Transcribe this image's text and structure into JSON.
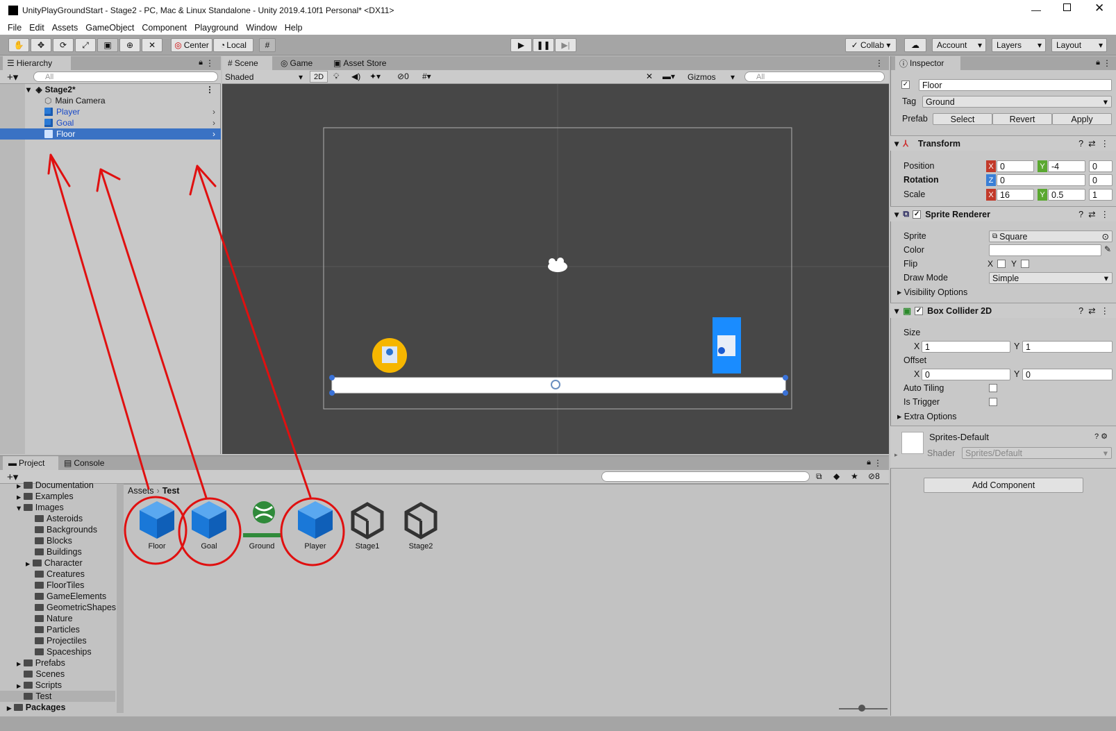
{
  "window": {
    "title": "UnityPlayGroundStart - Stage2 - PC, Mac & Linux Standalone - Unity 2019.4.10f1 Personal* <DX11>"
  },
  "menu": [
    "File",
    "Edit",
    "Assets",
    "GameObject",
    "Component",
    "Playground",
    "Window",
    "Help"
  ],
  "toolbar": {
    "pivot": "Center",
    "space": "Local",
    "collab": "Collab",
    "account": "Account",
    "layers": "Layers",
    "layout": "Layout"
  },
  "hierarchy": {
    "tab": "Hierarchy",
    "search": "All",
    "scene": "Stage2*",
    "items": [
      {
        "label": "Main Camera"
      },
      {
        "label": "Player"
      },
      {
        "label": "Goal"
      },
      {
        "label": "Floor"
      }
    ]
  },
  "scene": {
    "tabs": [
      "Scene",
      "Game",
      "Asset Store"
    ],
    "shading": "Shaded",
    "mode2d": "2D",
    "hidden_count": "0",
    "gizmos": "Gizmos",
    "search": "All"
  },
  "inspector": {
    "tab": "Inspector",
    "object_name": "Floor",
    "tag_label": "Tag",
    "tag": "Ground",
    "prefab_label": "Prefab",
    "prefab_select": "Select",
    "prefab_revert": "Revert",
    "prefab_apply": "Apply",
    "transform": {
      "title": "Transform",
      "position_label": "Position",
      "rotation_label": "Rotation",
      "scale_label": "Scale",
      "pos_x": "0",
      "pos_y": "-4",
      "pos_z": "0",
      "rot_z": "0",
      "rot_end": "0",
      "scale_x": "16",
      "scale_y": "0.5",
      "scale_z": "1"
    },
    "sprite_renderer": {
      "title": "Sprite Renderer",
      "sprite_label": "Sprite",
      "sprite": "Square",
      "color_label": "Color",
      "flip_label": "Flip",
      "draw_mode_label": "Draw Mode",
      "draw_mode": "Simple",
      "visibility": "Visibility Options"
    },
    "box_collider": {
      "title": "Box Collider 2D",
      "size_label": "Size",
      "size_x": "1",
      "size_y": "1",
      "offset_label": "Offset",
      "offset_x": "0",
      "offset_y": "0",
      "auto_tiling": "Auto Tiling",
      "is_trigger": "Is Trigger",
      "extra": "Extra Options"
    },
    "material": {
      "name": "Sprites-Default",
      "shader_label": "Shader",
      "shader": "Sprites/Default"
    },
    "add_component": "Add Component"
  },
  "project": {
    "tabs": [
      "Project",
      "Console"
    ],
    "hidden_count": "8",
    "breadcrumb": {
      "root": "Assets",
      "current": "Test"
    },
    "tree": [
      "Documentation",
      "Examples",
      "Images",
      "Asteroids",
      "Backgrounds",
      "Blocks",
      "Buildings",
      "Character",
      "Creatures",
      "FloorTiles",
      "GameElements",
      "GeometricShapes",
      "Nature",
      "Particles",
      "Projectiles",
      "Spaceships",
      "Prefabs",
      "Scenes",
      "Scripts",
      "Test",
      "Packages"
    ],
    "assets": [
      {
        "label": "Floor"
      },
      {
        "label": "Goal"
      },
      {
        "label": "Ground"
      },
      {
        "label": "Player"
      },
      {
        "label": "Stage1"
      },
      {
        "label": "Stage2"
      }
    ]
  },
  "colors": {
    "selection": "#3a72c4",
    "annotation": "#e01010",
    "scene_bg": "#474747",
    "accent_blue": "#1a8cff"
  }
}
